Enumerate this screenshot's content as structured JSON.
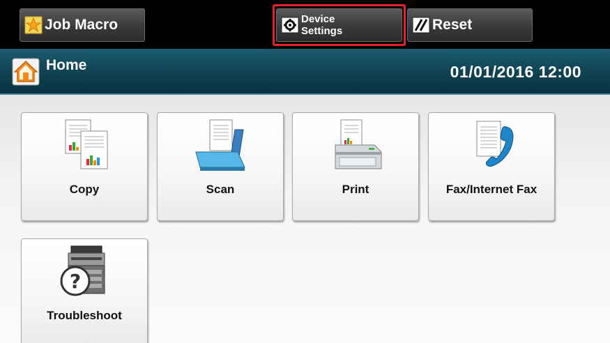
{
  "topbar": {
    "job_macro": "Job Macro",
    "device_settings_line1": "Device",
    "device_settings_line2": "Settings",
    "reset": "Reset"
  },
  "header": {
    "title": "Home",
    "datetime": "01/01/2016 12:00"
  },
  "tiles": [
    {
      "label": "Copy",
      "icon": "copy-icon"
    },
    {
      "label": "Scan",
      "icon": "scan-icon"
    },
    {
      "label": "Print",
      "icon": "print-icon"
    },
    {
      "label": "Fax/Internet Fax",
      "icon": "fax-icon"
    },
    {
      "label": "Troubleshoot",
      "icon": "troubleshoot-icon"
    }
  ],
  "colors": {
    "highlight": "#e8202a",
    "header": "#0f3f4f",
    "topbar": "#000000"
  }
}
